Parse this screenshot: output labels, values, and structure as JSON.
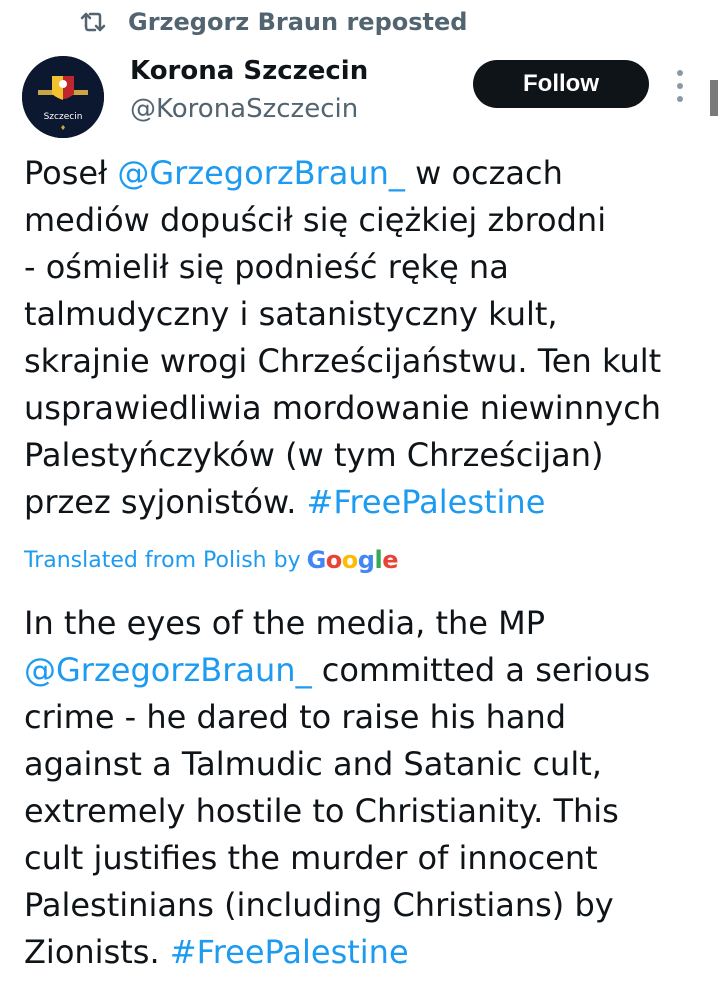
{
  "repost": {
    "icon": "repost-icon",
    "text": "Grzegorz Braun reposted"
  },
  "author": {
    "avatar_icon": "avatar-logo",
    "avatar_text": "Szczecin",
    "name": "Korona Szczecin",
    "handle": "@KoronaSzczecin"
  },
  "actions": {
    "follow_label": "Follow",
    "more_icon": "more-vertical-icon"
  },
  "tweet": {
    "original": {
      "l1_pre": "Poseł ",
      "l1_mention": "@GrzegorzBraun_",
      "l1_post": " w oczach",
      "l2": "mediów dopuścił się ciężkiej zbrodni",
      "l3": "- ośmielił się podnieść rękę na",
      "l4": "talmudyczny i satanistyczny kult,",
      "l5": "skrajnie wrogi Chrześcijaństwu. Ten kult",
      "l6": "usprawiedliwia mordowanie niewinnych",
      "l7": "Palestyńczyków (w tym Chrześcijan)",
      "l8_pre": "przez syjonistów. ",
      "l8_hashtag": "#FreePalestine"
    },
    "translated_by": {
      "label": "Translated from Polish by",
      "brand": "Google"
    },
    "translation": {
      "l1": "In the eyes of the media, the MP",
      "l2_mention": "@GrzegorzBraun_",
      "l2_post": " committed a serious",
      "l3": "crime - he dared to raise his hand",
      "l4": "against a Talmudic and Satanic cult,",
      "l5": "extremely hostile to Christianity. This",
      "l6": "cult justifies the murder of innocent",
      "l7": "Palestinians (including Christians) by",
      "l8_pre": "Zionists. ",
      "l8_hashtag": "#FreePalestine"
    }
  },
  "colors": {
    "link": "#1d9bf0",
    "text": "#0f1419",
    "secondary": "#536471",
    "follow_bg": "#0f1419"
  }
}
